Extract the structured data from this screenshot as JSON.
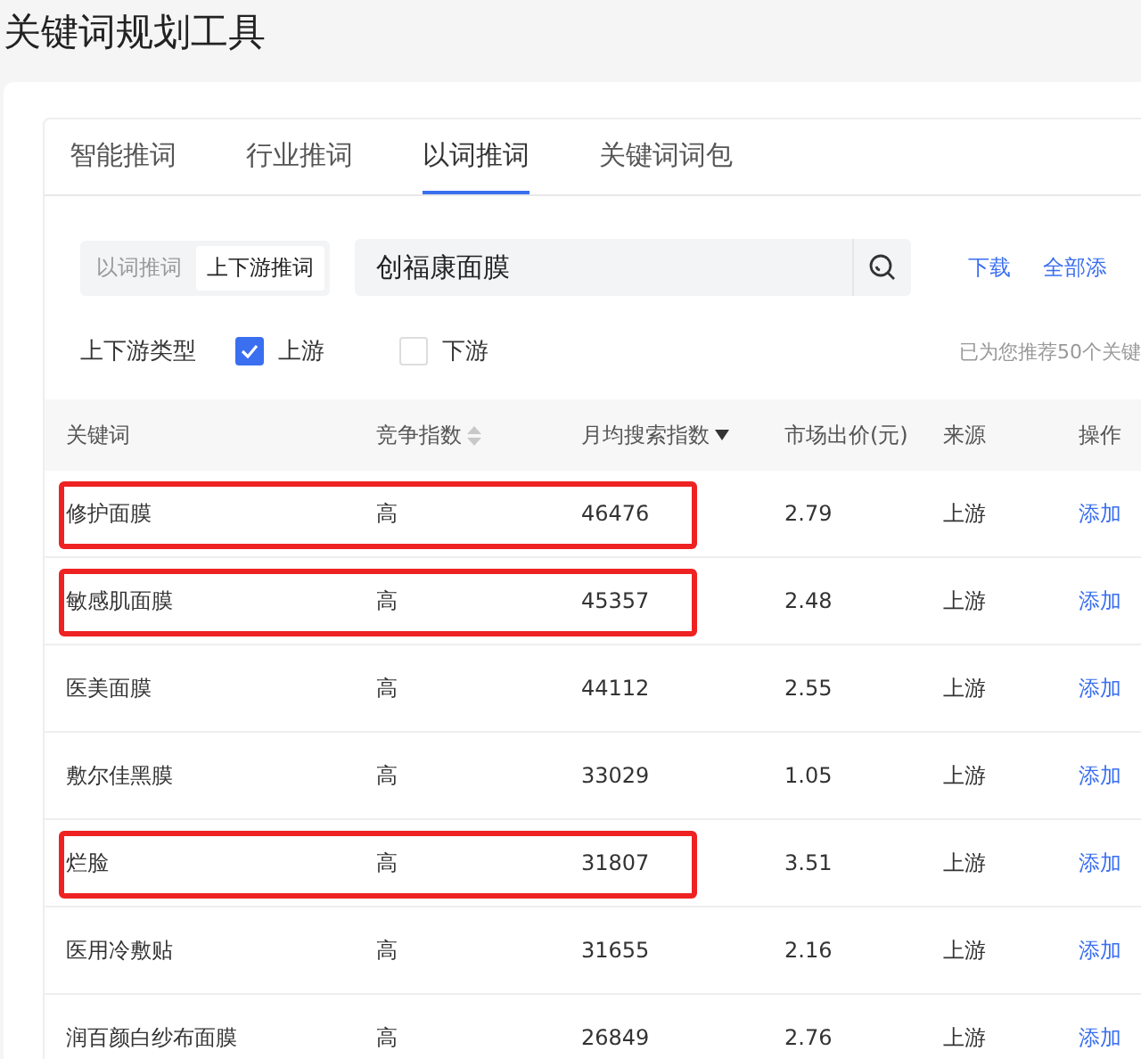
{
  "page": {
    "title": "关键词规划工具"
  },
  "tabs": [
    {
      "label": "智能推词",
      "selected": false
    },
    {
      "label": "行业推词",
      "selected": false
    },
    {
      "label": "以词推词",
      "selected": true
    },
    {
      "label": "关键词词包",
      "selected": false
    }
  ],
  "mode_switch": [
    {
      "label": "以词推词",
      "selected": false
    },
    {
      "label": "上下游推词",
      "selected": true
    }
  ],
  "search": {
    "value": "创福康面膜"
  },
  "actions": [
    "下载",
    "全部添"
  ],
  "filter": {
    "label": "上下游类型",
    "options": [
      {
        "label": "上游",
        "checked": true
      },
      {
        "label": "下游",
        "checked": false
      }
    ]
  },
  "summary": "已为您推荐50个关键",
  "table": {
    "columns": [
      {
        "label": "关键词"
      },
      {
        "label": "竞争指数",
        "sorted_desc": false
      },
      {
        "label": "月均搜索指数",
        "sorted_desc": true
      },
      {
        "label": "市场出价(元)"
      },
      {
        "label": "来源"
      },
      {
        "label": "操作"
      }
    ],
    "rows": [
      {
        "keyword": "修护面膜",
        "competition": "高",
        "search_index": "46476",
        "price": "2.79",
        "source": "上游",
        "action": "添加",
        "highlighted": true
      },
      {
        "keyword": "敏感肌面膜",
        "competition": "高",
        "search_index": "45357",
        "price": "2.48",
        "source": "上游",
        "action": "添加",
        "highlighted": true
      },
      {
        "keyword": "医美面膜",
        "competition": "高",
        "search_index": "44112",
        "price": "2.55",
        "source": "上游",
        "action": "添加",
        "highlighted": false
      },
      {
        "keyword": "敷尔佳黑膜",
        "competition": "高",
        "search_index": "33029",
        "price": "1.05",
        "source": "上游",
        "action": "添加",
        "highlighted": false
      },
      {
        "keyword": "烂脸",
        "competition": "高",
        "search_index": "31807",
        "price": "3.51",
        "source": "上游",
        "action": "添加",
        "highlighted": true
      },
      {
        "keyword": "医用冷敷贴",
        "competition": "高",
        "search_index": "31655",
        "price": "2.16",
        "source": "上游",
        "action": "添加",
        "highlighted": false
      },
      {
        "keyword": "润百颜白纱布面膜",
        "competition": "高",
        "search_index": "26849",
        "price": "2.76",
        "source": "上游",
        "action": "添加",
        "highlighted": false
      }
    ]
  }
}
